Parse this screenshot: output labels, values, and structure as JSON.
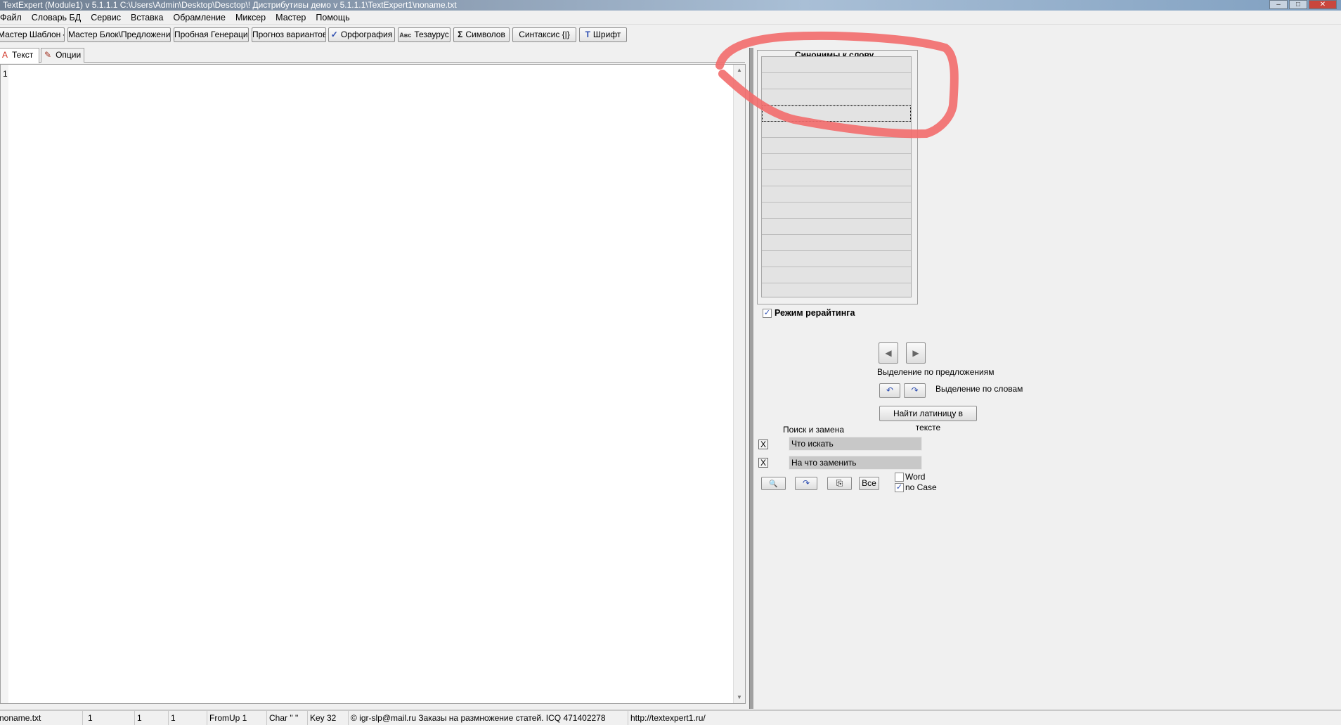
{
  "window": {
    "title": "TextExpert (Module1) v 5.1.1.1   C:\\Users\\Admin\\Desktop\\Desctop\\! Дистрибутивы демо v 5.1.1.1\\TextExpert1\\noname.txt",
    "min": "–",
    "max": "□",
    "close": "✕"
  },
  "menu": [
    "Файл",
    "Словарь БД",
    "Сервис",
    "Вставка",
    "Обрамление",
    "Миксер",
    "Мастер",
    "Помощь"
  ],
  "toolbar": [
    {
      "label": "Мастер Шаблон {|}",
      "icon": ""
    },
    {
      "label": "Мастер Блок\\Предложение",
      "icon": ""
    },
    {
      "label": "Пробная Генерация",
      "icon": ""
    },
    {
      "label": "Прогноз вариантов",
      "icon": ""
    },
    {
      "label": "Орфография",
      "icon": "✓"
    },
    {
      "label": "Тезаурус",
      "icon": "Aʙᴄ"
    },
    {
      "label": "Символов",
      "icon": "Σ"
    },
    {
      "label": "Синтаксис {|}",
      "icon": ""
    },
    {
      "label": "Шрифт",
      "icon": "T"
    }
  ],
  "tabs": [
    {
      "label": "Текст",
      "icon": "A"
    },
    {
      "label": "Опции",
      "icon": "✎"
    }
  ],
  "editor": {
    "line_number": "1"
  },
  "synonyms": {
    "title": "Синонимы к слову"
  },
  "rewrite_mode": {
    "label": "Режим рерайтинга",
    "checked": true
  },
  "sentence_nav": {
    "label": "Выделение по предложениям",
    "prev": "◀",
    "next": "▶"
  },
  "word_nav": {
    "label": "Выделение по словам",
    "prev": "↶",
    "next": "↷"
  },
  "find_latin": "Найти латиницу в тексте",
  "search": {
    "title": "Поиск и замена",
    "find_value": "Что искать",
    "replace_value": "На что заменить",
    "clear": "X",
    "find_btn": "🔍",
    "next_btn": "↷",
    "replace_btn": "⎘",
    "all_btn": "Все",
    "word_label": "Word",
    "word_checked": false,
    "nocase_label": "no Case",
    "nocase_checked": true
  },
  "status": [
    "noname.txt",
    "1",
    "1",
    "1",
    "FromUp 1",
    "Char \" \"",
    "Key 32",
    "© igr-slp@mail.ru Заказы на размножение статей. ICQ 471402278",
    "http://textexpert1.ru/"
  ],
  "colors": {
    "annotation": "#f26b6b"
  }
}
